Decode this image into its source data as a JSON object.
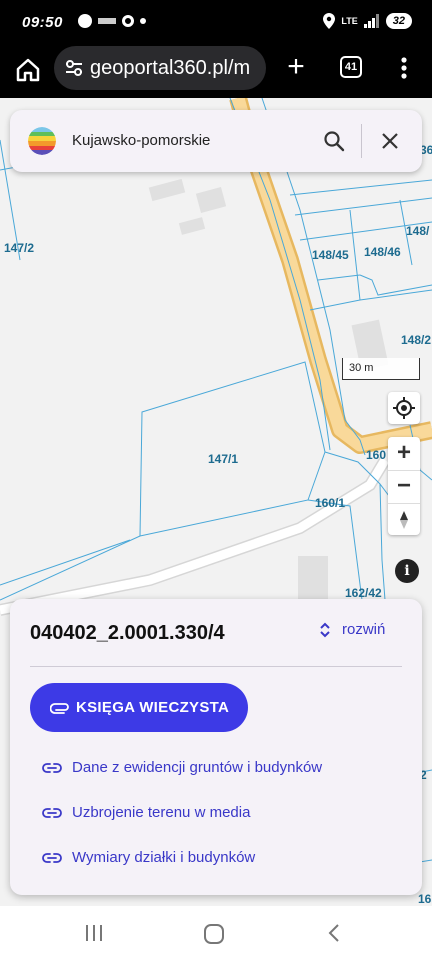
{
  "status_bar": {
    "time": "09:50",
    "network": "LTE",
    "battery": "32"
  },
  "browser": {
    "url": "geoportal360.pl/m",
    "tab_count": "41"
  },
  "search": {
    "query": "Kujawsko-pomorskie"
  },
  "map": {
    "parcels": [
      {
        "label": "147/2"
      },
      {
        "label": "148/45"
      },
      {
        "label": "148/46"
      },
      {
        "label": "148/"
      },
      {
        "label": "148/2"
      },
      {
        "label": "147/1"
      },
      {
        "label": "160"
      },
      {
        "label": "160/1"
      },
      {
        "label": "162/42"
      },
      {
        "label": "36"
      },
      {
        "label": "2"
      },
      {
        "label": "16"
      }
    ],
    "scale_label": "30 m",
    "accent_colors": {
      "parcel_line": "#4aa8d8",
      "parcel_label": "#1d6b8f",
      "road_fill": "#f9d99a",
      "road_edge": "#e7b860"
    }
  },
  "panel": {
    "parcel_id": "040402_2.0001.330/4",
    "expand_label": "rozwiń",
    "primary_button": "KSIĘGA WIECZYSTA",
    "links": [
      "Dane z ewidencji gruntów i budynków",
      "Uzbrojenie terenu w media",
      "Wymiary działki i budynków"
    ],
    "accent": "#3d3ae6"
  }
}
